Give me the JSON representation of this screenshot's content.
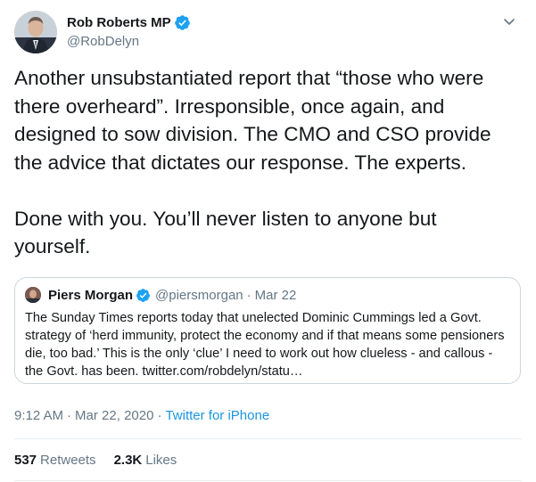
{
  "author": {
    "name": "Rob Roberts MP",
    "handle": "@RobDelyn",
    "verified_icon": "verified-badge-icon",
    "menu_icon": "chevron-down-icon"
  },
  "tweet": {
    "paragraph_1": "Another unsubstantiated report that “those who were there overheard”.  Irresponsible, once again, and designed to sow division. The CMO and CSO provide the advice that dictates our response. The experts.",
    "paragraph_2": "Done with you. You’ll never listen to anyone but yourself."
  },
  "quoted": {
    "name": "Piers Morgan",
    "handle": "@piersmorgan",
    "separator": "·",
    "date": "Mar 22",
    "text": "The Sunday Times reports today that unelected Dominic Cummings led a Govt. strategy of ‘herd immunity, protect the economy and if that means some pensioners die, too bad.’ This is the only ‘clue’ I need to work out how clueless - and callous - the Govt. has been. twitter.com/robdelyn/statu…"
  },
  "meta": {
    "time": "9:12 AM",
    "dot_1": "·",
    "date": "Mar 22, 2020",
    "dot_2": "·",
    "source": "Twitter for iPhone"
  },
  "stats": {
    "retweets_count": "537",
    "retweets_label": "Retweets",
    "likes_count": "2.3K",
    "likes_label": "Likes"
  },
  "colors": {
    "text": "#14171a",
    "secondary": "#657786",
    "link": "#1b95e0",
    "verified": "#1da1f2",
    "border": "#ccd6dd"
  }
}
